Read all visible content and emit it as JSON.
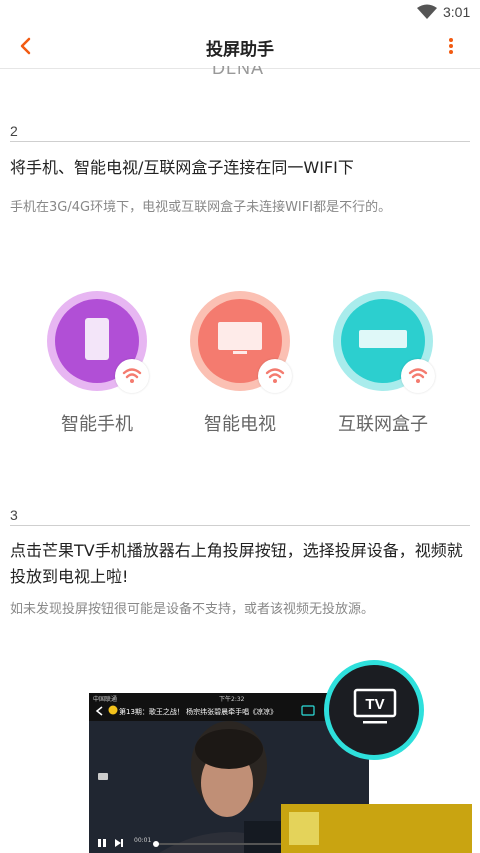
{
  "status_bar": {
    "time": "3:01"
  },
  "app_bar": {
    "title": "投屏助手"
  },
  "top_cut_text": "DLNA",
  "steps": [
    {
      "number": "2",
      "title": "将手机、智能电视/互联网盒子连接在同一WIFI下",
      "desc": "手机在3G/4G环境下，电视或互联网盒子未连接WIFI都是不行的。",
      "devices": [
        {
          "label": "智能手机",
          "color": "#b14fd6"
        },
        {
          "label": "智能电视",
          "color": "#f47b6f"
        },
        {
          "label": "互联网盒子",
          "color": "#2ccfcf"
        }
      ]
    },
    {
      "number": "3",
      "title": "点击芒果TV手机播放器右上角投屏按钮，选择投屏设备，视频就投放到电视上啦!",
      "desc": "如未发现投屏按钮很可能是设备不支持，或者该视频无投放源。"
    }
  ],
  "video": {
    "carrier": "中国联通",
    "clock": "下午2:32",
    "title": "第13期：歌王之战！ 杨宗纬张碧晨牵手唱《凉凉》",
    "time": "00:01"
  },
  "tv_button": {
    "label": "TV"
  },
  "colors": {
    "accent": "#f25b12",
    "tv_ring": "#2ee0dc"
  }
}
